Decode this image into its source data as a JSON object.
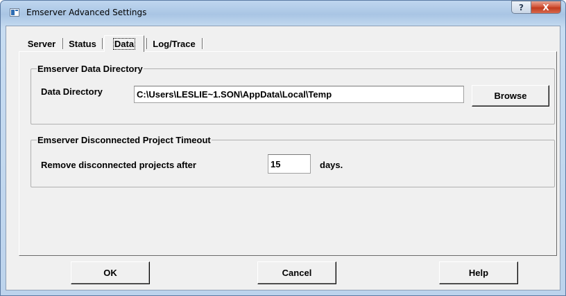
{
  "window": {
    "title": "Emserver Advanced Settings",
    "help_glyph": "?",
    "close_glyph": "X",
    "icon": "dialog-window-icon"
  },
  "tabs": [
    {
      "label": "Server",
      "selected": false
    },
    {
      "label": "Status",
      "selected": false
    },
    {
      "label": "Data",
      "selected": true
    },
    {
      "label": "Log/Trace",
      "selected": false
    }
  ],
  "data_directory_group": {
    "legend": "Emserver Data Directory",
    "field_label": "Data Directory",
    "value": "C:\\Users\\LESLIE~1.SON\\AppData\\Local\\Temp",
    "browse_label": "Browse"
  },
  "timeout_group": {
    "legend": "Emserver Disconnected Project Timeout",
    "prefix_label": "Remove disconnected projects after",
    "days_value": "15",
    "suffix_label": "days."
  },
  "footer": {
    "ok_label": "OK",
    "cancel_label": "Cancel",
    "help_label": "Help"
  },
  "colors": {
    "dialog_background": "#f0f0f0",
    "titlebar": "#bfd6ef",
    "close_button": "#c94a2e"
  }
}
